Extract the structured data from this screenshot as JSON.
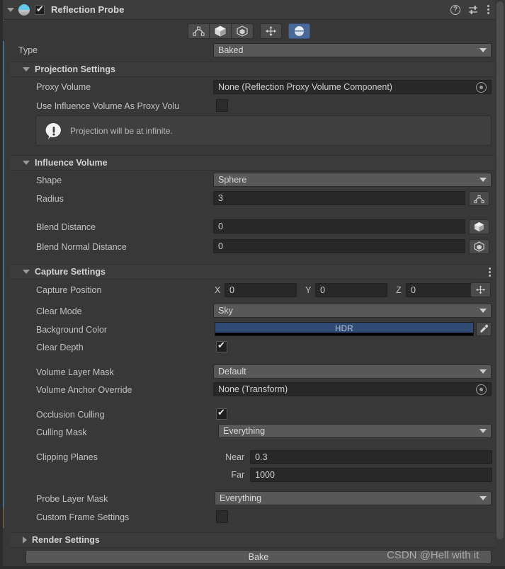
{
  "header": {
    "title": "Reflection Probe",
    "enabled_checkbox": true,
    "icons": [
      "reflection-probe-icon",
      "help-icon",
      "preset-icon",
      "more-menu-icon"
    ]
  },
  "toolbar": {
    "buttons": [
      {
        "name": "influence-volume-gizmo",
        "icon": "arc-handles-icon",
        "active": false
      },
      {
        "name": "blend-distance-gizmo",
        "icon": "filled-cube-icon",
        "active": false
      },
      {
        "name": "blend-normal-distance-gizmo",
        "icon": "wireframe-cube-icon",
        "active": false
      },
      {
        "name": "capture-position-gizmo",
        "icon": "move-arrows-icon",
        "active": false
      },
      {
        "name": "mirror-gizmo",
        "icon": "sphere-icon",
        "active": true
      }
    ]
  },
  "type_row": {
    "label": "Type",
    "value": "Baked"
  },
  "projection": {
    "title": "Projection Settings",
    "expanded": true,
    "proxy_volume": {
      "label": "Proxy Volume",
      "value": "None (Reflection Proxy Volume Component)"
    },
    "use_influence_as_proxy": {
      "label": "Use Influence Volume As Proxy Volu",
      "checked": false
    },
    "info": {
      "text": "Projection will be at infinite.",
      "icon": "info-exclamation-icon"
    }
  },
  "influence": {
    "title": "Influence Volume",
    "expanded": true,
    "shape": {
      "label": "Shape",
      "value": "Sphere"
    },
    "radius": {
      "label": "Radius",
      "value": "3",
      "gizmo": "arc-handles-icon"
    },
    "blend_distance": {
      "label": "Blend Distance",
      "value": "0",
      "gizmo": "filled-cube-icon"
    },
    "blend_normal_distance": {
      "label": "Blend Normal Distance",
      "value": "0",
      "gizmo": "wireframe-cube-icon"
    }
  },
  "capture": {
    "title": "Capture Settings",
    "expanded": true,
    "capture_position": {
      "label": "Capture Position",
      "axes": [
        {
          "axis": "X",
          "value": "0"
        },
        {
          "axis": "Y",
          "value": "0"
        },
        {
          "axis": "Z",
          "value": "0"
        }
      ],
      "gizmo": "move-arrows-icon"
    },
    "clear_mode": {
      "label": "Clear Mode",
      "value": "Sky"
    },
    "background_color": {
      "label": "Background Color",
      "badge": "HDR",
      "color": "#2f4a74",
      "alpha_color": "#000000",
      "picker_icon": "eyedropper-icon"
    },
    "clear_depth": {
      "label": "Clear Depth",
      "checked": true
    },
    "volume_layer_mask": {
      "label": "Volume Layer Mask",
      "value": "Default"
    },
    "volume_anchor_override": {
      "label": "Volume Anchor Override",
      "value": "None (Transform)"
    },
    "occlusion_culling": {
      "label": "Occlusion Culling",
      "checked": true
    },
    "culling_mask": {
      "label": "Culling Mask",
      "value": "Everything"
    },
    "clipping_planes": {
      "label": "Clipping Planes",
      "near": {
        "label": "Near",
        "value": "0.3"
      },
      "far": {
        "label": "Far",
        "value": "1000"
      }
    },
    "probe_layer_mask": {
      "label": "Probe Layer Mask",
      "value": "Everything"
    },
    "custom_frame_settings": {
      "label": "Custom Frame Settings",
      "checked": false
    }
  },
  "render_settings": {
    "title": "Render Settings",
    "expanded": false
  },
  "bake": {
    "label": "Bake"
  },
  "watermark": {
    "text": "CSDN @Hell with it"
  }
}
